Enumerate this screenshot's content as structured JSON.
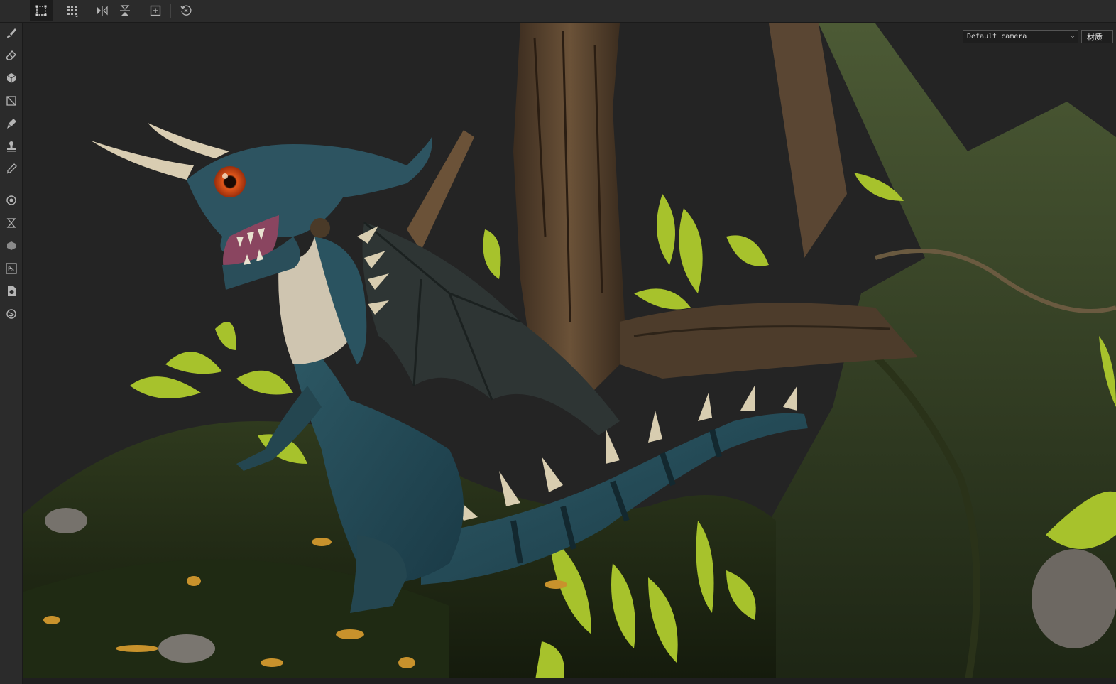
{
  "viewport": {
    "camera_select": {
      "value": "Default camera"
    },
    "material_button": {
      "label": "材质"
    }
  },
  "toolbar": {
    "buttons": [
      {
        "icon": "marquee-select-icon",
        "active": true
      },
      {
        "icon": "grid-view-icon"
      },
      {
        "icon": "mirror-horizontal-icon"
      },
      {
        "icon": "mirror-vertical-icon"
      },
      {
        "icon": "add-frame-icon"
      },
      {
        "icon": "history-reset-icon"
      }
    ]
  },
  "left_toolbar": {
    "tools": [
      "paint-brush-icon",
      "eraser-icon",
      "projection-icon",
      "polygon-fill-icon",
      "smudge-icon",
      "clone-stamp-icon",
      "color-picker-icon",
      "bake-settings-icon",
      "hourglass-icon",
      "substance-icon",
      "photoshop-icon",
      "export-document-icon",
      "plugin-icon"
    ]
  },
  "colors": {
    "toolbar_bg": "#2b2b2b",
    "viewport_bg": "#242424",
    "icon": "#b5b5b5"
  }
}
